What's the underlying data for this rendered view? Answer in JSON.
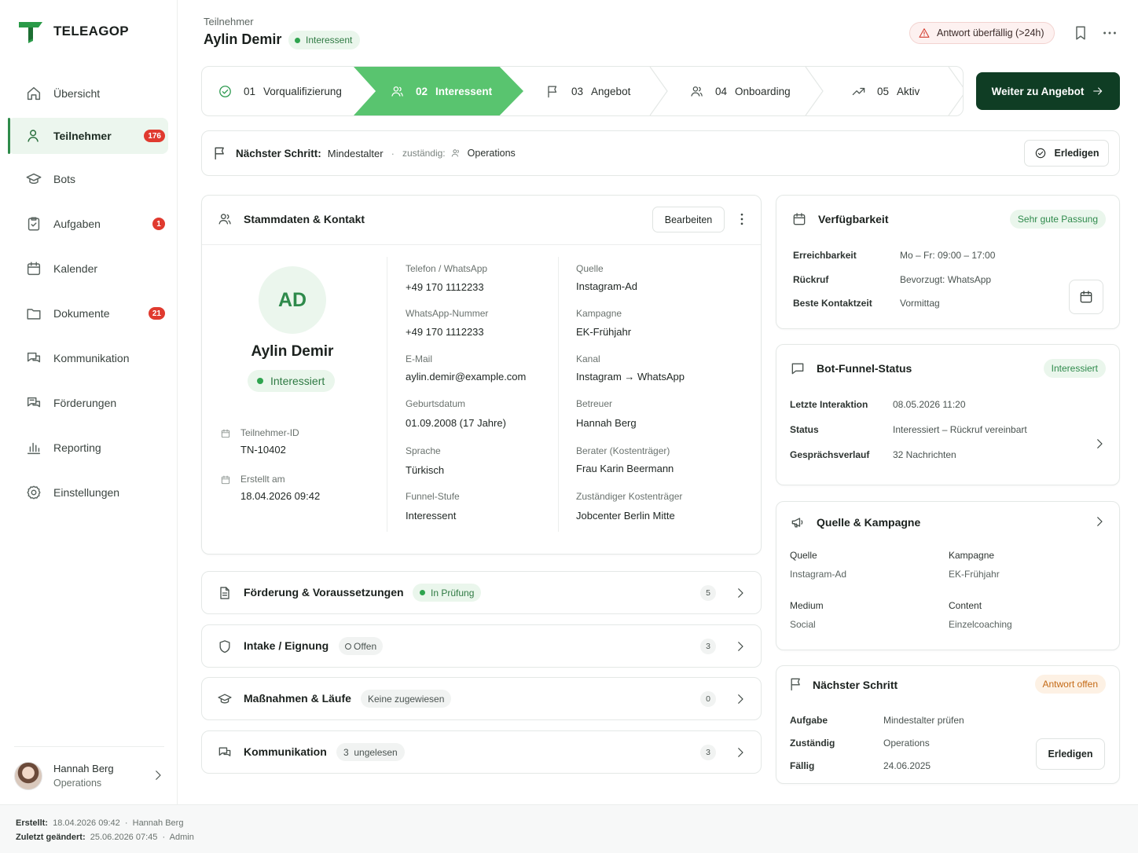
{
  "brand": {
    "name": "TELEAGOP",
    "logo_color": "#2a9a48"
  },
  "sidebar": {
    "items": [
      {
        "label": "Übersicht",
        "icon": "home-icon"
      },
      {
        "label": "Teilnehmer",
        "icon": "user-icon",
        "badge": "176",
        "active": true
      },
      {
        "label": "Bots",
        "icon": "graduation-cap-icon"
      },
      {
        "label": "Aufgaben",
        "icon": "clipboard-check-icon",
        "badge": "1"
      },
      {
        "label": "Kalender",
        "icon": "calendar-icon"
      },
      {
        "label": "Dokumente",
        "icon": "folder-icon",
        "badge": "21"
      },
      {
        "label": "Kommunikation",
        "icon": "chat-icon"
      },
      {
        "label": "Förderungen",
        "icon": "chat-stack-icon"
      },
      {
        "label": "Reporting",
        "icon": "bar-chart-icon"
      },
      {
        "label": "Einstellungen",
        "icon": "gear-icon"
      }
    ],
    "user": {
      "name": "Hannah Berg",
      "role": "Operations"
    }
  },
  "footer": {
    "created_label": "Erstellt:",
    "created_value": "18.04.2026 09:42",
    "created_by": "Hannah Berg",
    "changed_label": "Zuletzt geändert:",
    "changed_value": "25.06.2026 07:45",
    "changed_by": "Admin"
  },
  "header": {
    "subtitle": "Teilnehmer",
    "name": "Aylin Demir",
    "status": "Interessent",
    "overdue": "Antwort überfällig (>24h)"
  },
  "stepper": {
    "steps": [
      {
        "num": "01",
        "label": "Vorqualifizierung",
        "icon": "check-circle-icon",
        "state": "done"
      },
      {
        "num": "02",
        "label": "Interessent",
        "icon": "users-icon",
        "state": "active"
      },
      {
        "num": "03",
        "label": "Angebot",
        "icon": "flag-icon",
        "state": "open"
      },
      {
        "num": "04",
        "label": "Onboarding",
        "icon": "users-icon",
        "state": "open"
      },
      {
        "num": "05",
        "label": "Aktiv",
        "icon": "trending-up-icon",
        "state": "open"
      }
    ],
    "next_button": "Weiter zu Angebot",
    "active_color": "#59c46f"
  },
  "next_step_bar": {
    "label": "Nächster Schritt:",
    "value": "Mindestalter",
    "responsible_label": "zuständig:",
    "responsible": "Operations",
    "done_button": "Erledigen"
  },
  "stammdaten": {
    "title": "Stammdaten & Kontakt",
    "edit_button": "Bearbeiten",
    "initials": "AD",
    "name": "Aylin Demir",
    "status": "Interessiert",
    "id_label": "Teilnehmer-ID",
    "id_value": "TN-10402",
    "created_label": "Erstellt am",
    "created_value": "18.04.2026 09:42",
    "col1": [
      {
        "k": "Telefon / WhatsApp",
        "v": "+49 170 1112233"
      },
      {
        "k": "WhatsApp-Nummer",
        "v": "+49 170 1112233"
      },
      {
        "k": "E-Mail",
        "v": "aylin.demir@example.com"
      },
      {
        "k": "Geburtsdatum",
        "v": "01.09.2008 (17 Jahre)"
      },
      {
        "k": "Sprache",
        "v": "Türkisch"
      },
      {
        "k": "Funnel-Stufe",
        "v": "Interessent"
      }
    ],
    "col2": [
      {
        "k": "Quelle",
        "v": "Instagram-Ad"
      },
      {
        "k": "Kampagne",
        "v": "EK-Frühjahr"
      },
      {
        "k": "Kanal",
        "v": "Instagram → WhatsApp"
      },
      {
        "k": "Betreuer",
        "v": "Hannah Berg"
      },
      {
        "k": "Berater (Kostenträger)",
        "v": "Frau Karin Beermann"
      },
      {
        "k": "Zuständiger Kostenträger",
        "v": "Jobcenter Berlin Mitte"
      }
    ]
  },
  "sections": [
    {
      "title": "Förderung & Voraussetzungen",
      "pill": "In Prüfung",
      "pill_style": "green",
      "count": "5",
      "icon": "document-icon"
    },
    {
      "title": "Intake / Eignung",
      "pill": "Offen",
      "pill_style": "ring",
      "count": "3",
      "icon": "shield-icon"
    },
    {
      "title": "Maßnahmen & Läufe",
      "pill": "Keine zugewiesen",
      "pill_style": "grey",
      "count": "0",
      "icon": "graduation-cap-icon"
    },
    {
      "title": "Kommunikation",
      "pill": "3  ungelesen",
      "pill_style": "grey",
      "count": "3",
      "icon": "chat-icon"
    }
  ],
  "availability": {
    "title": "Verfügbarkeit",
    "pill": "Sehr gute Passung",
    "rows": [
      {
        "k": "Erreichbarkeit",
        "v": "Mo – Fr: 09:00 – 17:00"
      },
      {
        "k": "Rückruf",
        "v": "Bevorzugt: WhatsApp"
      },
      {
        "k": "Beste Kontaktzeit",
        "v": "Vormittag"
      }
    ]
  },
  "bot_funnel": {
    "title": "Bot-Funnel-Status",
    "pill": "Interessiert",
    "rows": [
      {
        "k": "Letzte Interaktion",
        "v": "08.05.2026 11:20"
      },
      {
        "k": "Status",
        "v": "Interessiert – Rückruf vereinbart"
      },
      {
        "k": "Gesprächsverlauf",
        "v": "32 Nachrichten"
      }
    ]
  },
  "source_campaign": {
    "title": "Quelle & Kampagne",
    "items": [
      {
        "k": "Quelle",
        "v": "Instagram-Ad"
      },
      {
        "k": "Kampagne",
        "v": "EK-Frühjahr"
      },
      {
        "k": "Medium",
        "v": "Social"
      },
      {
        "k": "Content",
        "v": "Einzelcoaching"
      }
    ]
  },
  "next_step_card": {
    "title": "Nächster Schritt",
    "pill": "Antwort offen",
    "rows": [
      {
        "k": "Aufgabe",
        "v": "Mindestalter prüfen"
      },
      {
        "k": "Zuständig",
        "v": "Operations"
      },
      {
        "k": "Fällig",
        "v": "24.06.2025"
      }
    ],
    "done_button": "Erledigen"
  }
}
